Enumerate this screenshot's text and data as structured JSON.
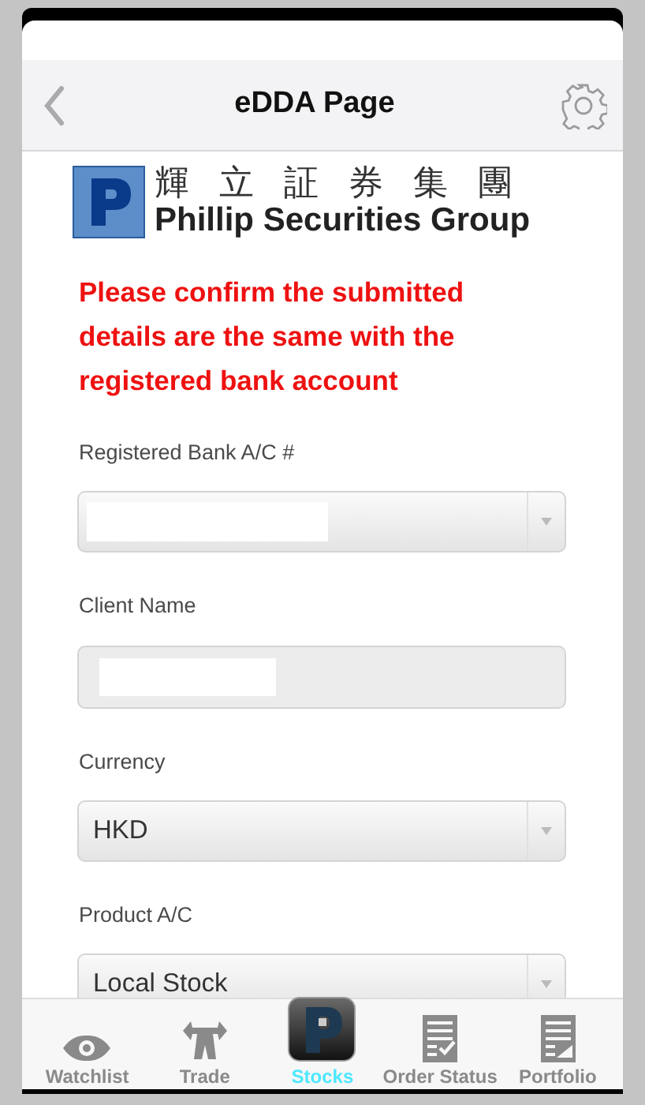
{
  "nav": {
    "title": "eDDA Page"
  },
  "logo": {
    "chinese": "輝 立 証 券 集 團",
    "english": "Phillip Securities Group"
  },
  "notice": "Please confirm the submitted details are the same with the registered bank account",
  "fields": [
    {
      "label": "Registered Bank A/C #",
      "kind": "select",
      "redacted": true
    },
    {
      "label": "Client Name",
      "kind": "text",
      "redacted": true
    },
    {
      "label": "Currency",
      "kind": "select",
      "value": "HKD",
      "redacted": false
    },
    {
      "label": "Product A/C",
      "kind": "select",
      "value": "Local Stock",
      "redacted": false
    }
  ],
  "tabs": [
    {
      "label": "Watchlist",
      "selected": false
    },
    {
      "label": "Trade",
      "selected": false
    },
    {
      "label": "Stocks",
      "selected": true
    },
    {
      "label": "Order Status",
      "selected": false
    },
    {
      "label": "Portfolio",
      "selected": false
    }
  ]
}
